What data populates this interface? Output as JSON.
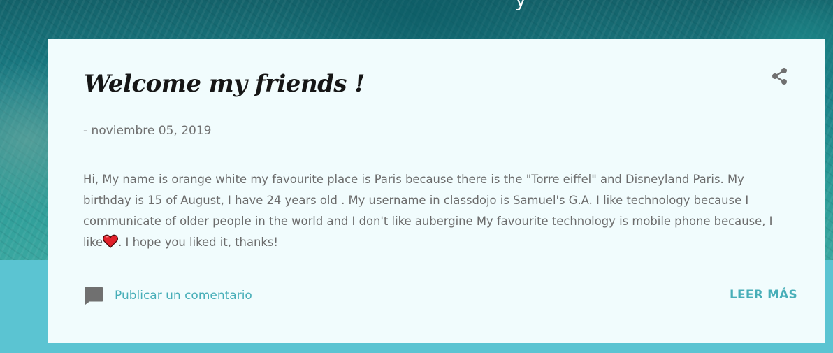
{
  "colors": {
    "card_background": "#f1fcfd",
    "accent": "#47aeb8",
    "page_background": "#5bc4d2",
    "title_text": "#161616",
    "body_text": "#6c6c6c",
    "icon_gray": "#707070",
    "heart_red": "#e0202a"
  },
  "header": {
    "title_fragment": "y"
  },
  "post": {
    "title": "Welcome my friends !",
    "date": "- noviembre 05, 2019",
    "body_before_heart": "Hi,  My name is orange white my favourite place is Paris because there is the \"Torre eiffel\" and Disneyland Paris.  My birthday is 15 of August, I have 24 years old . My username in classdojo is Samuel's G.A. I like technology because I communicate of older people in the world and I don't like aubergine  My favourite technology is mobile phone because, I like",
    "body_after_heart": ".  I hope you liked it, thanks!",
    "share_icon": "share-icon",
    "heart_icon": "heart-icon"
  },
  "footer": {
    "comment_icon": "comment-icon",
    "comment_label": "Publicar un comentario",
    "read_more_label": "LEER MÁS"
  }
}
